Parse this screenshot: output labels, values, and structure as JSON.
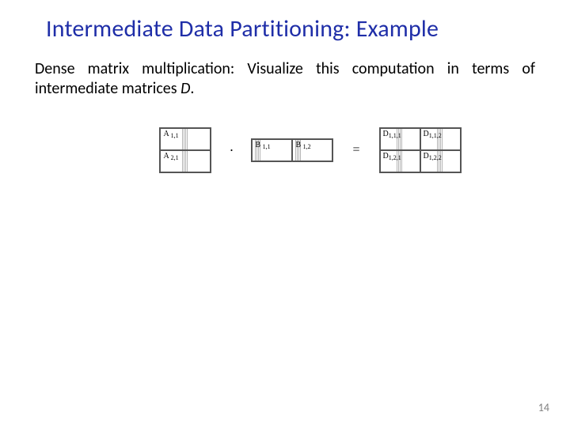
{
  "title": "Intermediate Data Partitioning: Example",
  "body": {
    "pre": "Dense matrix multiplication: Visualize this computation in terms of intermediate matrices ",
    "italic": "D",
    "post": "."
  },
  "diagram": {
    "A": {
      "cells": [
        "A 1,1",
        "A 2,1"
      ]
    },
    "dot": "·",
    "B": {
      "cells": [
        "B 1,1",
        "B 1,2"
      ]
    },
    "eq": "=",
    "D": {
      "cells": [
        "D1,1,1",
        "D1,1,2",
        "D1,2,1",
        "D1,2,2"
      ]
    }
  },
  "pageNumber": "14"
}
